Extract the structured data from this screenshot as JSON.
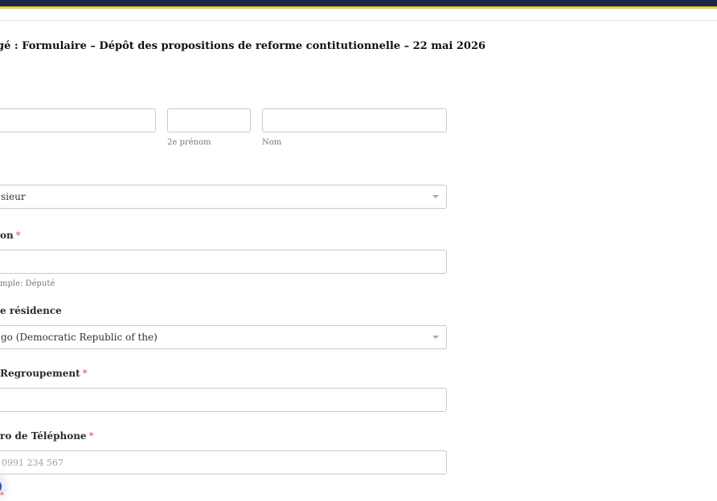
{
  "form": {
    "title": "gé : Formulaire – Dépôt des propositions de reforme contitutionnelle – 22 mai 2026"
  },
  "name_fields": {
    "middle_sublabel": "2e prénom",
    "last_sublabel": "Nom"
  },
  "civility": {
    "selected": "sieur"
  },
  "function": {
    "label": "on",
    "required": "*",
    "help": "mple: Député"
  },
  "residence": {
    "label": "e résidence",
    "selected": "go (Democratic Republic of the)"
  },
  "group": {
    "label": "Regroupement",
    "required": "*"
  },
  "phone": {
    "label": "ro de Téléphone",
    "required": "*",
    "placeholder": "0991 234 567"
  },
  "widget": {
    "required": "*"
  },
  "colors": {
    "header": "#1c2745",
    "accent": "#e2d23a",
    "required": "#d9534f"
  }
}
